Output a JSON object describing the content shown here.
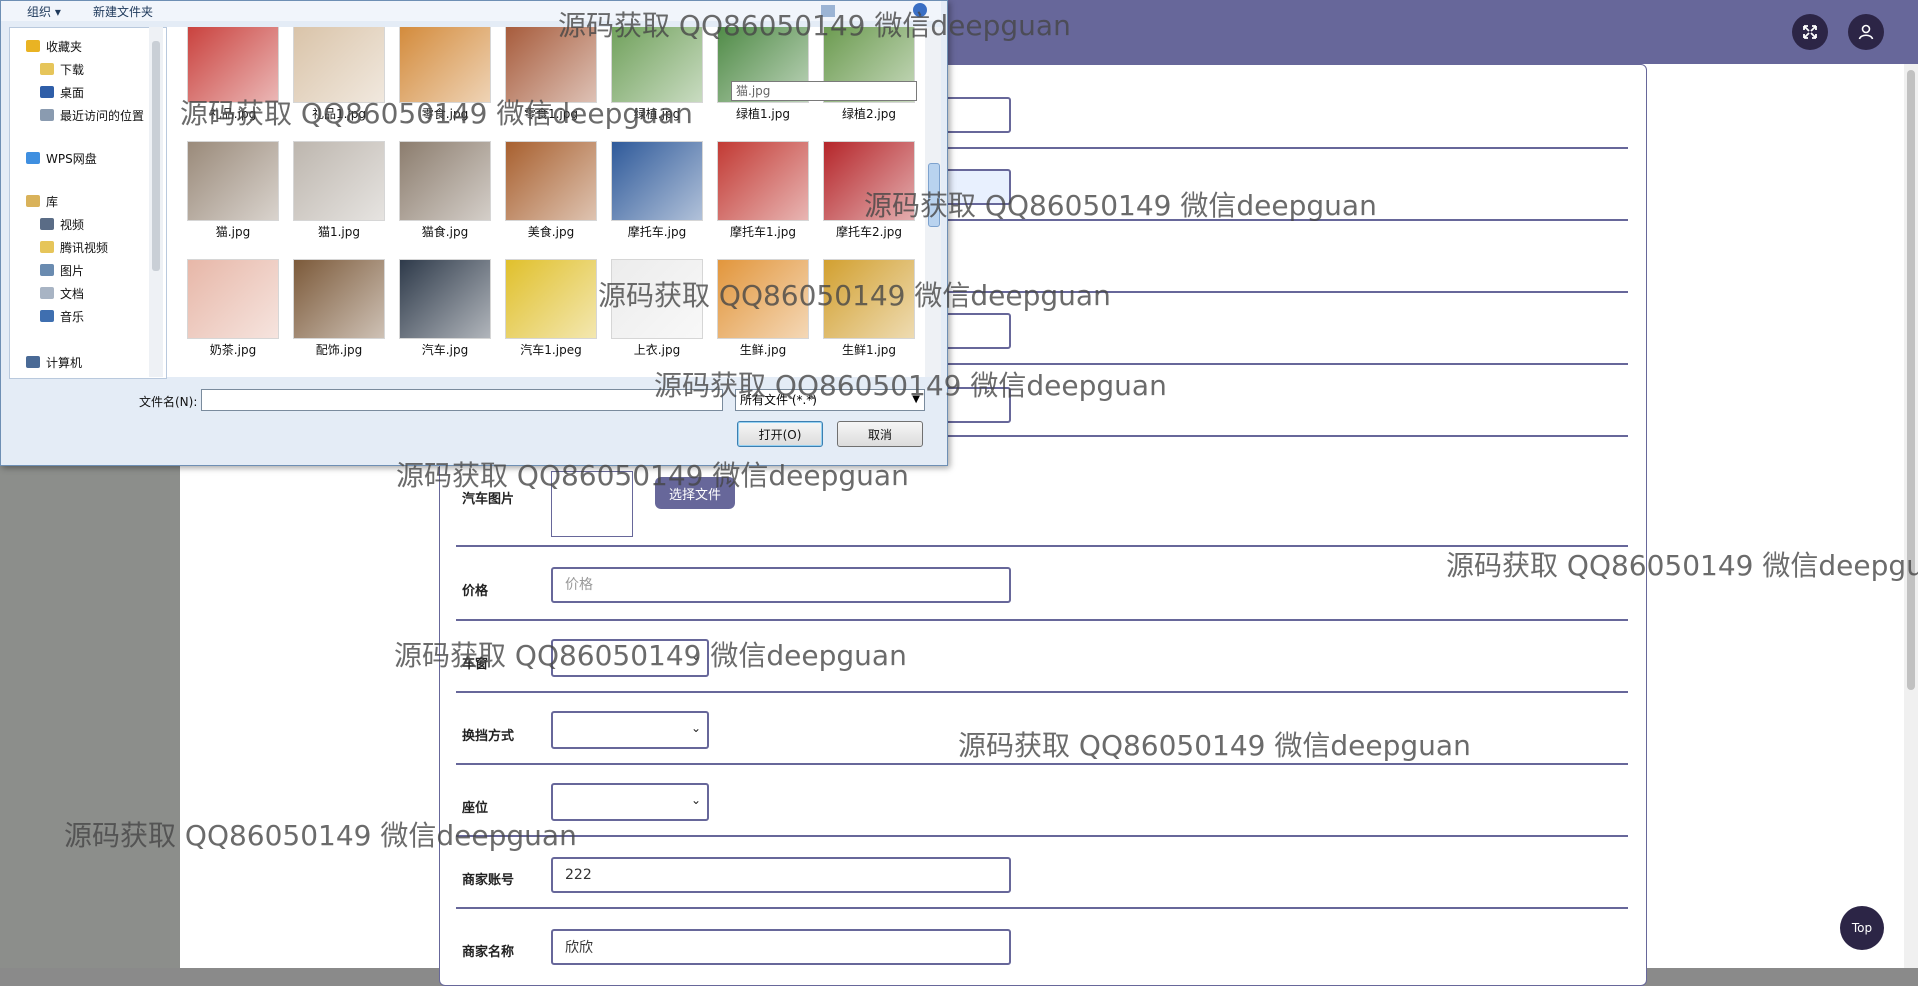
{
  "dialog": {
    "toolbar": {
      "organize": "组织 ▾",
      "new_folder": "新建文件夹"
    },
    "nav": {
      "favorites": "收藏夹",
      "downloads": "下载",
      "desktop": "桌面",
      "recent": "最近访问的位置",
      "wps": "WPS网盘",
      "library": "库",
      "videos": "视频",
      "tencent_video": "腾讯视频",
      "pictures": "图片",
      "documents": "文档",
      "music": "音乐",
      "computer": "计算机"
    },
    "files": [
      {
        "name": "礼品.jpg",
        "color": "#c9403c"
      },
      {
        "name": "礼品1.jpg",
        "color": "#d9c3a8"
      },
      {
        "name": "零食.jpg",
        "color": "#d38a3a"
      },
      {
        "name": "零食1.jpg",
        "color": "#a65a3a"
      },
      {
        "name": "绿植.jpg",
        "color": "#6fa05a"
      },
      {
        "name": "绿植1.jpg",
        "color": "#4e8a45"
      },
      {
        "name": "绿植2.jpg",
        "color": "#6a9a4e"
      },
      {
        "name": "猫.jpg",
        "color": "#9a8a7a"
      },
      {
        "name": "猫1.jpg",
        "color": "#bdb6ae"
      },
      {
        "name": "猫食.jpg",
        "color": "#8c7d6e"
      },
      {
        "name": "美食.jpg",
        "color": "#a8602f"
      },
      {
        "name": "摩托车.jpg",
        "color": "#2f5a9a"
      },
      {
        "name": "摩托车1.jpg",
        "color": "#c23a34"
      },
      {
        "name": "摩托车2.jpg",
        "color": "#b5262a"
      },
      {
        "name": "奶茶.jpg",
        "color": "#e7b7a8"
      },
      {
        "name": "配饰.jpg",
        "color": "#7c5a3a"
      },
      {
        "name": "汽车.jpg",
        "color": "#2e3a4a"
      },
      {
        "name": "汽车1.jpeg",
        "color": "#e0c02c"
      },
      {
        "name": "上衣.jpg",
        "color": "#ececec"
      },
      {
        "name": "生鲜.jpg",
        "color": "#e2963c"
      },
      {
        "name": "生鲜1.jpg",
        "color": "#d2a030"
      }
    ],
    "rename_value": "猫.jpg",
    "filename_label": "文件名(N):",
    "filename_value": "",
    "filter": "所有文件 (*.*)",
    "open_button": "打开(O)",
    "cancel_button": "取消"
  },
  "form": {
    "car_image_label": "汽车图片",
    "choose_file": "选择文件",
    "price_label": "价格",
    "price_placeholder": "价格",
    "color_label": "车窗",
    "gear_label": "换挡方式",
    "seat_label": "座位",
    "merchant_account_label": "商家账号",
    "merchant_account_value": "222",
    "merchant_name_label": "商家名称",
    "merchant_name_value": "欣欣"
  },
  "top_button": "Top",
  "watermark": "源码获取 QQ86050149 微信deepguan",
  "colors": {
    "accent": "#67679a",
    "dark": "#2c2546"
  }
}
